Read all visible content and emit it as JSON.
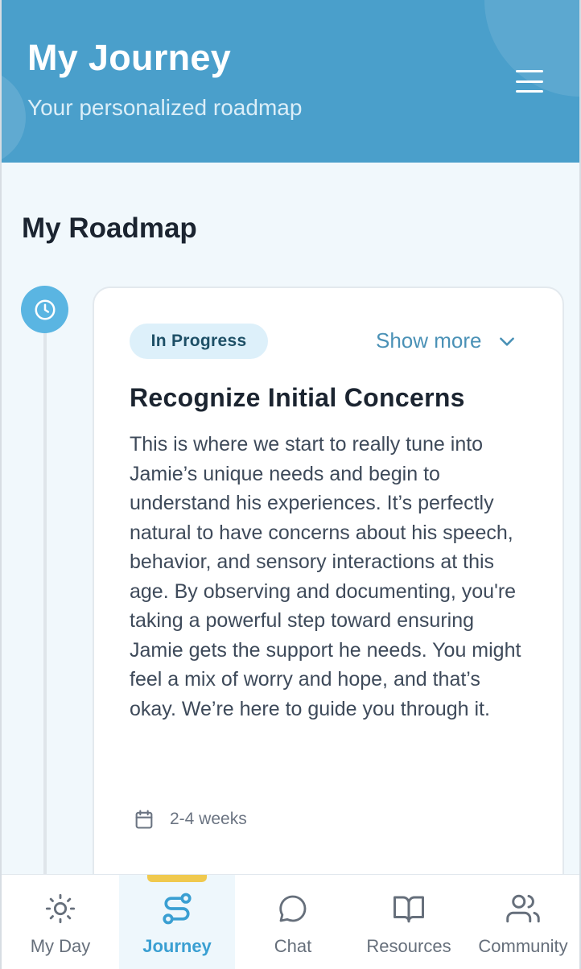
{
  "header": {
    "title": "My Journey",
    "subtitle": "Your personalized roadmap",
    "menu_icon": "hamburger-menu-icon",
    "background_color": "#4a9fcb"
  },
  "roadmap": {
    "section_title": "My Roadmap",
    "timeline_icon": "clock-icon",
    "card": {
      "status": "In Progress",
      "show_more_label": "Show more",
      "title": "Recognize Initial Concerns",
      "body": "This is where we start to really tune into Jamie’s unique needs and begin to understand his experiences. It’s perfectly natural to have concerns about his speech, behavior, and sensory interactions at this age. By observing and documenting, you're taking a powerful step toward ensuring Jamie gets the support he needs. You might feel a mix of worry and hope, and that’s okay. We’re here to guide you through it.",
      "duration": "2-4 weeks",
      "duration_icon": "calendar-icon"
    }
  },
  "bottom_nav": {
    "items": [
      {
        "label": "My Day",
        "icon": "sun-icon"
      },
      {
        "label": "Journey",
        "icon": "route-icon",
        "active": true
      },
      {
        "label": "Chat",
        "icon": "chat-bubble-icon"
      },
      {
        "label": "Resources",
        "icon": "book-icon"
      },
      {
        "label": "Community",
        "icon": "users-icon"
      }
    ],
    "active_color": "#3a9fd2",
    "indicator_color": "#f0c94e"
  }
}
